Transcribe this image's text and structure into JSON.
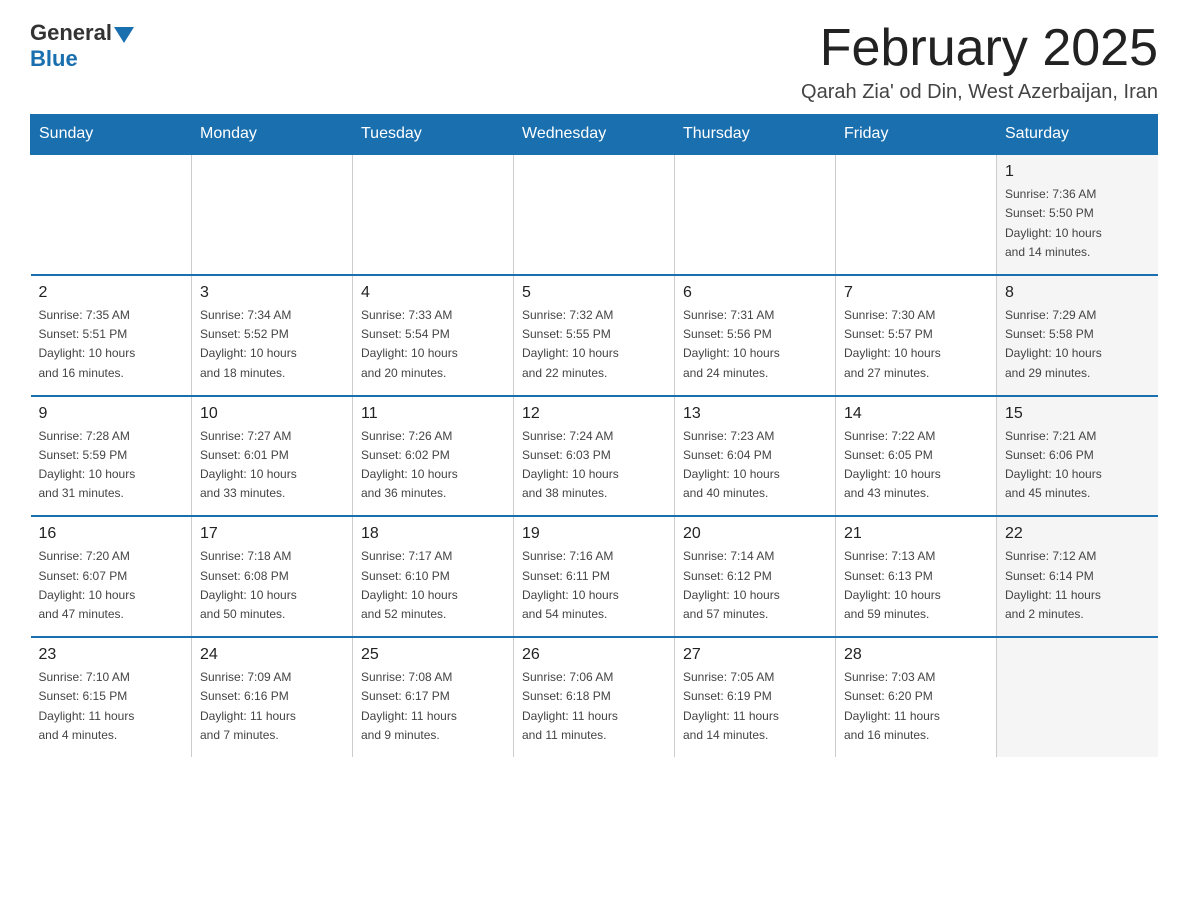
{
  "logo": {
    "general": "General",
    "blue": "Blue"
  },
  "header": {
    "title": "February 2025",
    "subtitle": "Qarah Zia' od Din, West Azerbaijan, Iran"
  },
  "weekdays": [
    "Sunday",
    "Monday",
    "Tuesday",
    "Wednesday",
    "Thursday",
    "Friday",
    "Saturday"
  ],
  "weeks": [
    [
      {
        "day": "",
        "info": ""
      },
      {
        "day": "",
        "info": ""
      },
      {
        "day": "",
        "info": ""
      },
      {
        "day": "",
        "info": ""
      },
      {
        "day": "",
        "info": ""
      },
      {
        "day": "",
        "info": ""
      },
      {
        "day": "1",
        "info": "Sunrise: 7:36 AM\nSunset: 5:50 PM\nDaylight: 10 hours\nand 14 minutes."
      }
    ],
    [
      {
        "day": "2",
        "info": "Sunrise: 7:35 AM\nSunset: 5:51 PM\nDaylight: 10 hours\nand 16 minutes."
      },
      {
        "day": "3",
        "info": "Sunrise: 7:34 AM\nSunset: 5:52 PM\nDaylight: 10 hours\nand 18 minutes."
      },
      {
        "day": "4",
        "info": "Sunrise: 7:33 AM\nSunset: 5:54 PM\nDaylight: 10 hours\nand 20 minutes."
      },
      {
        "day": "5",
        "info": "Sunrise: 7:32 AM\nSunset: 5:55 PM\nDaylight: 10 hours\nand 22 minutes."
      },
      {
        "day": "6",
        "info": "Sunrise: 7:31 AM\nSunset: 5:56 PM\nDaylight: 10 hours\nand 24 minutes."
      },
      {
        "day": "7",
        "info": "Sunrise: 7:30 AM\nSunset: 5:57 PM\nDaylight: 10 hours\nand 27 minutes."
      },
      {
        "day": "8",
        "info": "Sunrise: 7:29 AM\nSunset: 5:58 PM\nDaylight: 10 hours\nand 29 minutes."
      }
    ],
    [
      {
        "day": "9",
        "info": "Sunrise: 7:28 AM\nSunset: 5:59 PM\nDaylight: 10 hours\nand 31 minutes."
      },
      {
        "day": "10",
        "info": "Sunrise: 7:27 AM\nSunset: 6:01 PM\nDaylight: 10 hours\nand 33 minutes."
      },
      {
        "day": "11",
        "info": "Sunrise: 7:26 AM\nSunset: 6:02 PM\nDaylight: 10 hours\nand 36 minutes."
      },
      {
        "day": "12",
        "info": "Sunrise: 7:24 AM\nSunset: 6:03 PM\nDaylight: 10 hours\nand 38 minutes."
      },
      {
        "day": "13",
        "info": "Sunrise: 7:23 AM\nSunset: 6:04 PM\nDaylight: 10 hours\nand 40 minutes."
      },
      {
        "day": "14",
        "info": "Sunrise: 7:22 AM\nSunset: 6:05 PM\nDaylight: 10 hours\nand 43 minutes."
      },
      {
        "day": "15",
        "info": "Sunrise: 7:21 AM\nSunset: 6:06 PM\nDaylight: 10 hours\nand 45 minutes."
      }
    ],
    [
      {
        "day": "16",
        "info": "Sunrise: 7:20 AM\nSunset: 6:07 PM\nDaylight: 10 hours\nand 47 minutes."
      },
      {
        "day": "17",
        "info": "Sunrise: 7:18 AM\nSunset: 6:08 PM\nDaylight: 10 hours\nand 50 minutes."
      },
      {
        "day": "18",
        "info": "Sunrise: 7:17 AM\nSunset: 6:10 PM\nDaylight: 10 hours\nand 52 minutes."
      },
      {
        "day": "19",
        "info": "Sunrise: 7:16 AM\nSunset: 6:11 PM\nDaylight: 10 hours\nand 54 minutes."
      },
      {
        "day": "20",
        "info": "Sunrise: 7:14 AM\nSunset: 6:12 PM\nDaylight: 10 hours\nand 57 minutes."
      },
      {
        "day": "21",
        "info": "Sunrise: 7:13 AM\nSunset: 6:13 PM\nDaylight: 10 hours\nand 59 minutes."
      },
      {
        "day": "22",
        "info": "Sunrise: 7:12 AM\nSunset: 6:14 PM\nDaylight: 11 hours\nand 2 minutes."
      }
    ],
    [
      {
        "day": "23",
        "info": "Sunrise: 7:10 AM\nSunset: 6:15 PM\nDaylight: 11 hours\nand 4 minutes."
      },
      {
        "day": "24",
        "info": "Sunrise: 7:09 AM\nSunset: 6:16 PM\nDaylight: 11 hours\nand 7 minutes."
      },
      {
        "day": "25",
        "info": "Sunrise: 7:08 AM\nSunset: 6:17 PM\nDaylight: 11 hours\nand 9 minutes."
      },
      {
        "day": "26",
        "info": "Sunrise: 7:06 AM\nSunset: 6:18 PM\nDaylight: 11 hours\nand 11 minutes."
      },
      {
        "day": "27",
        "info": "Sunrise: 7:05 AM\nSunset: 6:19 PM\nDaylight: 11 hours\nand 14 minutes."
      },
      {
        "day": "28",
        "info": "Sunrise: 7:03 AM\nSunset: 6:20 PM\nDaylight: 11 hours\nand 16 minutes."
      },
      {
        "day": "",
        "info": ""
      }
    ]
  ]
}
